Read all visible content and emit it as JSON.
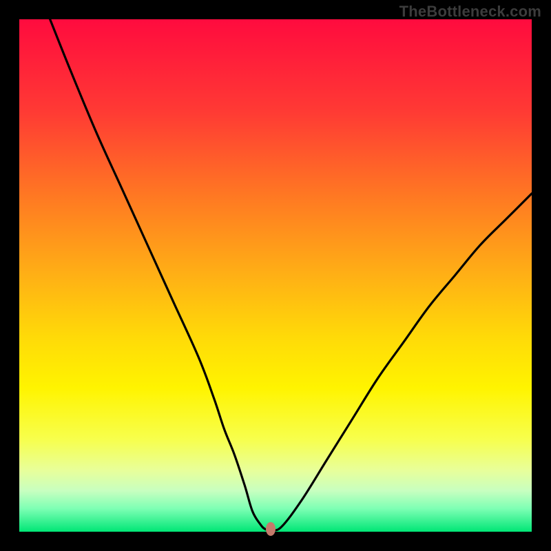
{
  "watermark": "TheBottleneck.com",
  "chart_data": {
    "type": "line",
    "title": "",
    "xlabel": "",
    "ylabel": "",
    "xlim": [
      0,
      100
    ],
    "ylim": [
      0,
      100
    ],
    "series": [
      {
        "name": "curve",
        "x": [
          6,
          10,
          15,
          20,
          25,
          30,
          35,
          38,
          40,
          42,
          44,
          45.5,
          47,
          48,
          49,
          51,
          55,
          60,
          65,
          70,
          75,
          80,
          85,
          90,
          95,
          100
        ],
        "y": [
          100,
          90,
          78,
          67,
          56,
          45,
          34,
          26,
          20,
          15,
          9,
          4,
          1.5,
          0.5,
          0.5,
          0.8,
          6,
          14,
          22,
          30,
          37,
          44,
          50,
          56,
          61,
          66
        ]
      }
    ],
    "marker": {
      "x": 49,
      "y": 0.5
    },
    "background_gradient": {
      "top": "#ff0b3e",
      "mid": "#ffda08",
      "bottom": "#00e676"
    }
  }
}
